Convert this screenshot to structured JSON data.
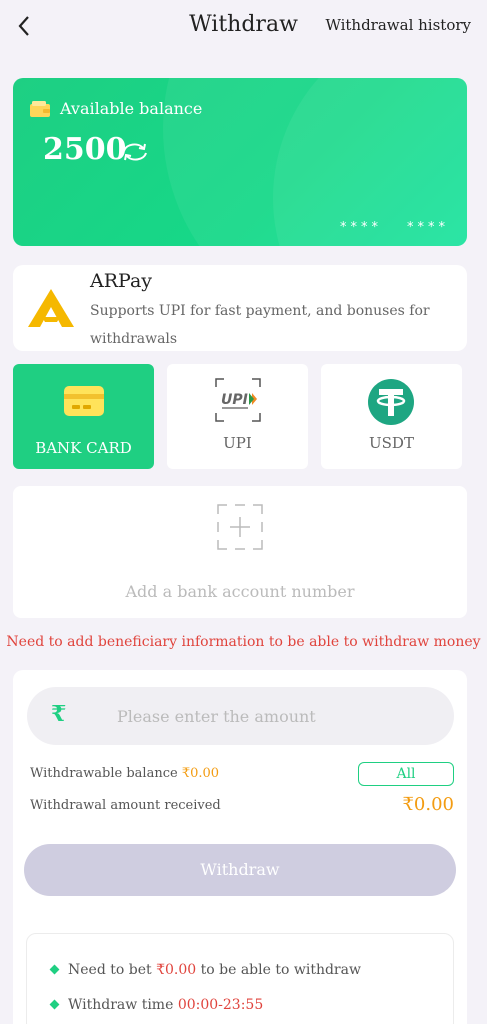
{
  "header": {
    "title": "Withdraw",
    "history_link": "Withdrawal history"
  },
  "balance_card": {
    "label": "Available balance",
    "amount": "2500",
    "card_mask_1": "****",
    "card_mask_2": "****"
  },
  "payment_provider": {
    "name": "ARPay",
    "description": "Supports UPI for fast payment, and bonuses for withdrawals"
  },
  "methods": [
    {
      "label": "BANK CARD",
      "active": true
    },
    {
      "label": "UPI",
      "active": false
    },
    {
      "label": "USDT",
      "active": false
    }
  ],
  "add_bank": {
    "label": "Add a bank account number"
  },
  "warning": "Need to add beneficiary information to be able to withdraw money",
  "form": {
    "currency_symbol": "₹",
    "amount_placeholder": "Please enter the amount",
    "withdrawable_label": "Withdrawable balance",
    "withdrawable_value": "₹0.00",
    "all_button": "All",
    "received_label": "Withdrawal amount received",
    "received_value": "₹0.00",
    "withdraw_button": "Withdraw"
  },
  "info": {
    "bet_prefix": "Need to bet",
    "bet_value": "₹0.00",
    "bet_suffix": "to be able to withdraw",
    "time_prefix": "Withdraw time",
    "time_value": "00:00-23:55"
  },
  "colors": {
    "accent": "#1fcf82",
    "warning": "#e0443d",
    "amount": "#f39c12"
  }
}
